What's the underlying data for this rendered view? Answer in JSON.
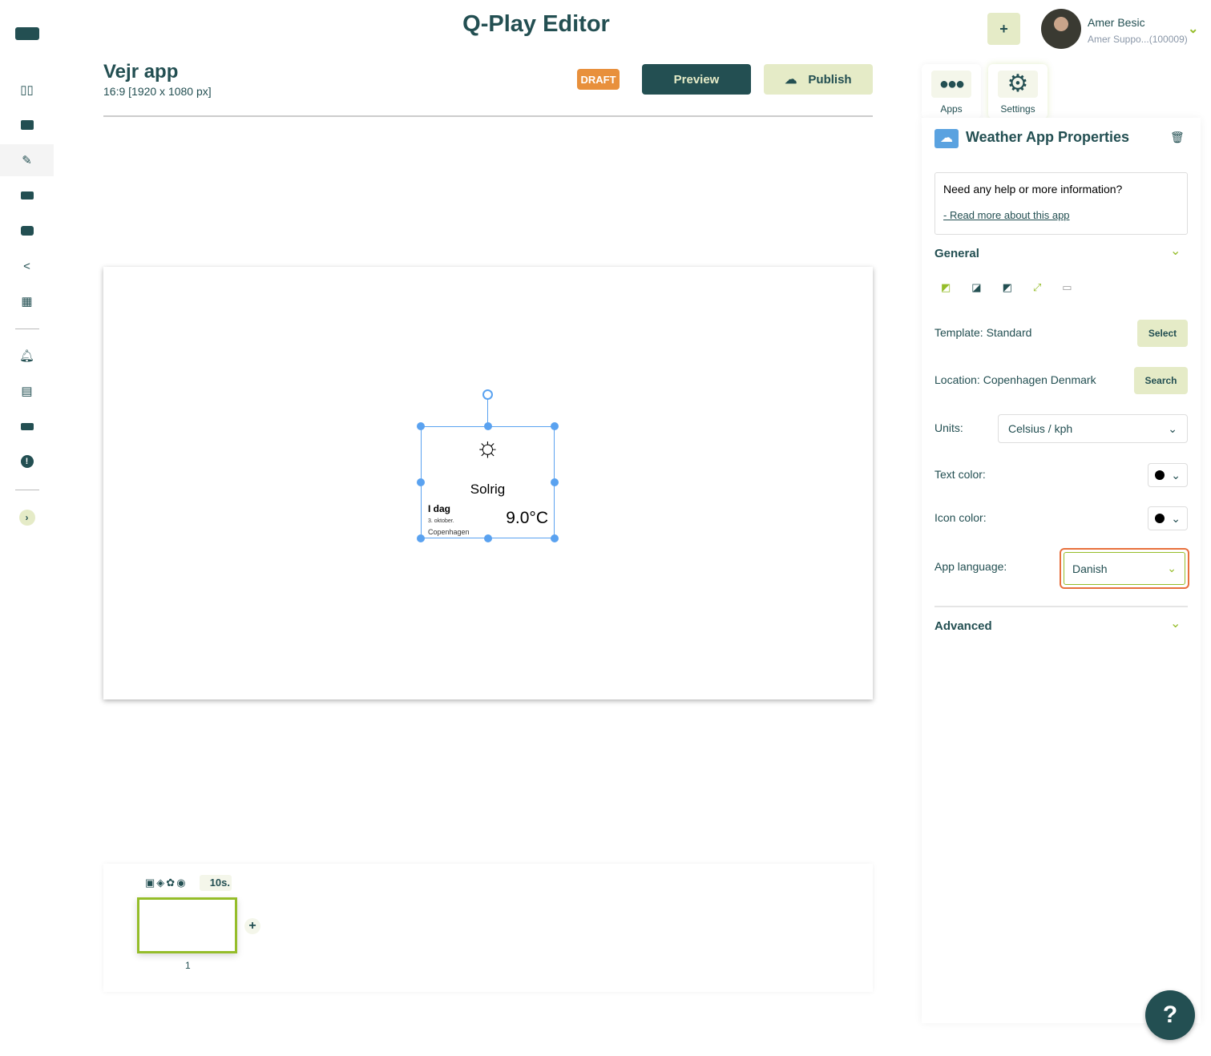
{
  "app_title": "Q-Play Editor",
  "colors": {
    "primary": "#234f52",
    "accent_light": "#e5ebc7",
    "accent_green": "#95bd2a",
    "draft": "#e8903c",
    "selection": "#5aa2f0",
    "focus": "#e8703c"
  },
  "sidebar": {
    "items": [
      {
        "icon": "logo-bar-icon"
      },
      {
        "icon": "dashboard-icon"
      },
      {
        "icon": "media-icon"
      },
      {
        "icon": "editor-icon",
        "active": true
      },
      {
        "icon": "screens-icon"
      },
      {
        "icon": "playlist-icon"
      },
      {
        "icon": "share-icon"
      },
      {
        "icon": "schedule-icon"
      },
      {
        "icon": "alarm-icon"
      },
      {
        "icon": "news-icon"
      },
      {
        "icon": "display-icon"
      },
      {
        "icon": "alert-icon"
      },
      {
        "icon": "expand-icon"
      }
    ]
  },
  "header": {
    "add_label": "+",
    "user_name": "Amer Besic",
    "user_org": "Amer Suppo...(100009)"
  },
  "project": {
    "name": "Vejr app",
    "resolution": "16:9 [1920 x 1080 px]",
    "status": "DRAFT",
    "preview_label": "Preview",
    "publish_label": "Publish"
  },
  "widget": {
    "condition": "Solrig",
    "day": "I dag",
    "date": "3. oktober.",
    "city": "Copenhagen",
    "temperature": "9.0°C"
  },
  "timeline": {
    "duration": "10s.",
    "slide_number": "1",
    "add_label": "+"
  },
  "panel": {
    "tabs": [
      {
        "label": "Apps"
      },
      {
        "label": "Settings"
      }
    ],
    "title": "Weather App Properties",
    "help_text": "Need any help or more information?",
    "help_link": "- Read more about this app",
    "general_label": "General",
    "template_label": "Template: Standard",
    "template_button": "Select",
    "location_label": "Location: Copenhagen Denmark",
    "location_button": "Search",
    "units_label": "Units:",
    "units_value": "Celsius / kph",
    "text_color_label": "Text color:",
    "text_color": "#000000",
    "icon_color_label": "Icon color:",
    "icon_color": "#000000",
    "language_label": "App language:",
    "language_value": "Danish",
    "advanced_label": "Advanced",
    "help_button": "?"
  }
}
